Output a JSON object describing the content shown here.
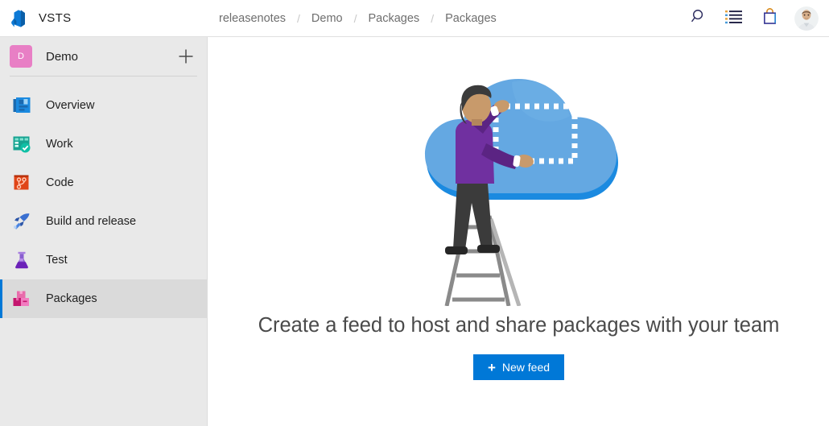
{
  "brand": {
    "name": "VSTS",
    "logo_icon": "vsts-logo-icon"
  },
  "breadcrumb": {
    "separator": "/",
    "items": [
      {
        "label": "releasenotes"
      },
      {
        "label": "Demo"
      },
      {
        "label": "Packages"
      },
      {
        "label": "Packages"
      }
    ]
  },
  "topbar_actions": [
    {
      "icon": "search-icon",
      "name": "search-button"
    },
    {
      "icon": "work-items-icon",
      "name": "work-items-button"
    },
    {
      "icon": "marketplace-bag-icon",
      "name": "marketplace-button"
    }
  ],
  "user": {
    "avatar_icon": "avatar"
  },
  "sidebar": {
    "project": {
      "initial": "D",
      "name": "Demo",
      "tile_color": "#e87fc5",
      "add_icon": "plus-icon",
      "add_label": "New"
    },
    "items": [
      {
        "label": "Overview",
        "icon": "overview-icon",
        "selected": false
      },
      {
        "label": "Work",
        "icon": "work-icon",
        "selected": false
      },
      {
        "label": "Code",
        "icon": "code-icon",
        "selected": false
      },
      {
        "label": "Build and release",
        "icon": "build-icon",
        "selected": false
      },
      {
        "label": "Test",
        "icon": "test-icon",
        "selected": false
      },
      {
        "label": "Packages",
        "icon": "packages-icon",
        "selected": true
      }
    ]
  },
  "main": {
    "illustration_icon": "cloud-person-ladder-illustration",
    "title": "Create a feed to host and share packages with your team",
    "new_feed_button": {
      "label": "New feed",
      "plus": "+"
    }
  },
  "colors": {
    "accent": "#0078d7",
    "sidebar_bg": "#e9e9e9",
    "sidebar_selected_bg": "#dadada",
    "project_tile": "#e87fc5",
    "title_text": "#4a4a4a",
    "breadcrumb_text": "#6e6e6e"
  }
}
